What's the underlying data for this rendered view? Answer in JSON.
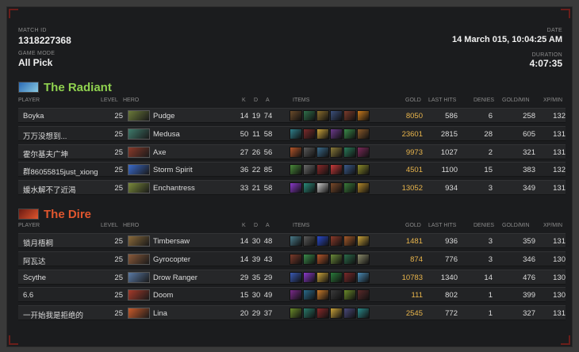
{
  "match": {
    "match_id_label": "MATCH ID",
    "match_id": "1318227368",
    "game_mode_label": "GAME MODE",
    "game_mode": "All Pick",
    "date_label": "DATE",
    "date": "14 March   015, 10:04:25 AM",
    "duration_label": "DURATION",
    "duration": "4:07:35"
  },
  "headers": {
    "player": "PLAYER",
    "level": "LEVEL",
    "hero": "HERO",
    "k": "K",
    "d": "D",
    "a": "A",
    "items": "ITEMS",
    "gold": "GOLD",
    "last_hits": "LAST HITS",
    "denies": "DENIES",
    "gold_min": "GOLD/MIN",
    "xp_min": "XP/MIN"
  },
  "colors": {
    "radiant": "#8fd14f",
    "dire": "#e0562e",
    "gold": "#e9b54b"
  },
  "radiant": {
    "name": "The Radiant",
    "icon": "radiant-team-icon",
    "players": [
      {
        "player": "Boyka",
        "level": "25",
        "hero": "Pudge",
        "hero_color": "#6b7a3a",
        "k": "14",
        "d": "19",
        "a": "74",
        "gold": "8050",
        "last_hits": "586",
        "denies": "6",
        "gpm": "258",
        "xpm": "132",
        "items": [
          "#6a4b2a",
          "#2f6f4a",
          "#8a6d2c",
          "#3b4f7a",
          "#7a3b2b",
          "#c97a1c"
        ]
      },
      {
        "player": "万万没想到...",
        "level": "25",
        "hero": "Medusa",
        "hero_color": "#3e7a6b",
        "k": "50",
        "d": "11",
        "a": "58",
        "gold": "23601",
        "last_hits": "2815",
        "denies": "28",
        "gpm": "605",
        "xpm": "131",
        "items": [
          "#2f7f8a",
          "#7a2b2b",
          "#c9a23a",
          "#6b3a8a",
          "#3a8a4a",
          "#8a5a2a"
        ]
      },
      {
        "player": "霍尔基夫广坤",
        "level": "25",
        "hero": "Axe",
        "hero_color": "#8a3a2a",
        "k": "27",
        "d": "26",
        "a": "56",
        "gold": "9973",
        "last_hits": "1027",
        "denies": "2",
        "gpm": "321",
        "xpm": "131",
        "items": [
          "#b5562a",
          "#5a5a5a",
          "#3a6a8a",
          "#8a7a3a",
          "#2a7a5a",
          "#7a2a5a"
        ]
      },
      {
        "player": "群86055815just_xiong",
        "level": "25",
        "hero": "Storm Spirit",
        "hero_color": "#3a6ac9",
        "k": "36",
        "d": "22",
        "a": "85",
        "gold": "4501",
        "last_hits": "1100",
        "denies": "15",
        "gpm": "383",
        "xpm": "132",
        "items": [
          "#4a8a3a",
          "#6a6a6a",
          "#8a2a2a",
          "#c93a3a",
          "#3a5a8a",
          "#8a8a2a"
        ]
      },
      {
        "player": "媛水解不了近渴",
        "level": "25",
        "hero": "Enchantress",
        "hero_color": "#7a8a3a",
        "k": "33",
        "d": "21",
        "a": "58",
        "gold": "13052",
        "last_hits": "934",
        "denies": "3",
        "gpm": "349",
        "xpm": "131",
        "items": [
          "#8a3ac9",
          "#2a8a7a",
          "#c9c9c9",
          "#7a4a2a",
          "#3a7a3a",
          "#b58a2a"
        ]
      }
    ]
  },
  "dire": {
    "name": "The Dire",
    "icon": "dire-team-icon",
    "players": [
      {
        "player": "锁月梧桐",
        "level": "25",
        "hero": "Timbersaw",
        "hero_color": "#8a6a3a",
        "k": "14",
        "d": "30",
        "a": "48",
        "gold": "1481",
        "last_hits": "936",
        "denies": "3",
        "gpm": "359",
        "xpm": "131",
        "items": [
          "#4a7a8a",
          "#5a5a5a",
          "#2a4ac9",
          "#8a3a2a",
          "#a55a2a",
          "#c9a23a"
        ]
      },
      {
        "player": "阿瓦达",
        "level": "25",
        "hero": "Gyrocopter",
        "hero_color": "#8a5a3a",
        "k": "14",
        "d": "39",
        "a": "43",
        "gold": "874",
        "last_hits": "776",
        "denies": "3",
        "gpm": "346",
        "xpm": "130",
        "items": [
          "#7a3a2a",
          "#3a8a4a",
          "#b5562a",
          "#6a8a3a",
          "#2a6a4a",
          "#8a8a6a"
        ]
      },
      {
        "player": "Scythe",
        "level": "25",
        "hero": "Drow Ranger",
        "hero_color": "#5a7aa5",
        "k": "29",
        "d": "35",
        "a": "29",
        "gold": "10783",
        "last_hits": "1340",
        "denies": "14",
        "gpm": "476",
        "xpm": "130",
        "items": [
          "#3a5ab5",
          "#8a3ac9",
          "#c9a23a",
          "#2a7a3a",
          "#7a2a2a",
          "#4a8ab5"
        ]
      },
      {
        "player": "6.6",
        "level": "25",
        "hero": "Doom",
        "hero_color": "#a53a2a",
        "k": "15",
        "d": "30",
        "a": "49",
        "gold": "111",
        "last_hits": "802",
        "denies": "1",
        "gpm": "399",
        "xpm": "130",
        "items": [
          "#7a2a8a",
          "#2a6a8a",
          "#c97a2a",
          "#3a3a3a",
          "#6a8a2a",
          "#5a2a2a"
        ]
      },
      {
        "player": "一开始我是拒绝的",
        "level": "25",
        "hero": "Lina",
        "hero_color": "#c95a2a",
        "k": "20",
        "d": "29",
        "a": "37",
        "gold": "2545",
        "last_hits": "772",
        "denies": "1",
        "gpm": "327",
        "xpm": "131",
        "items": [
          "#6a8a2a",
          "#2a7a6a",
          "#8a2a2a",
          "#c9a23a",
          "#4a4a7a",
          "#2a8a8a"
        ]
      }
    ]
  }
}
